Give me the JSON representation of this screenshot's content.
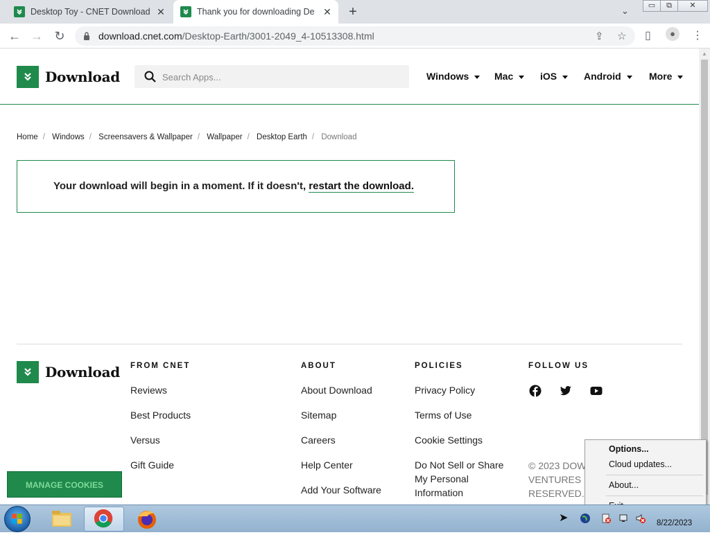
{
  "browser": {
    "tabs": [
      {
        "title": "Desktop Toy - CNET Download",
        "active": false
      },
      {
        "title": "Thank you for downloading Des",
        "active": true
      }
    ],
    "url_host": "download.cnet.com",
    "url_path": "/Desktop-Earth/3001-2049_4-10513308.html"
  },
  "header": {
    "logo_text": "Download",
    "search_placeholder": "Search Apps...",
    "nav": [
      "Windows",
      "Mac",
      "iOS",
      "Android",
      "More"
    ]
  },
  "breadcrumb": [
    "Home",
    "Windows",
    "Screensavers & Wallpaper",
    "Wallpaper",
    "Desktop Earth",
    "Download"
  ],
  "message": {
    "text": "Your download will begin in a moment. If it doesn't,",
    "link": "restart the download."
  },
  "footer": {
    "logo_text": "Download",
    "columns": [
      {
        "heading": "FROM CNET",
        "links": [
          "Reviews",
          "Best Products",
          "Versus",
          "Gift Guide"
        ]
      },
      {
        "heading": "ABOUT",
        "links": [
          "About Download",
          "Sitemap",
          "Careers",
          "Help Center",
          "Add Your Software"
        ]
      },
      {
        "heading": "POLICIES",
        "links": [
          "Privacy Policy",
          "Terms of Use",
          "Cookie Settings",
          "Do Not Sell or Share",
          "My Personal",
          "Information"
        ]
      },
      {
        "heading": "FOLLOW US",
        "links": []
      }
    ],
    "social": [
      "facebook-icon",
      "twitter-icon",
      "youtube-icon"
    ],
    "copyright": [
      "© 2023 DOW",
      "VENTURES C",
      "RESERVED."
    ]
  },
  "cookie_button": "MANAGE COOKIES",
  "context_menu": [
    "Options...",
    "Cloud updates...",
    "About...",
    "Exit"
  ],
  "taskbar": {
    "apps": [
      "file-explorer-icon",
      "chrome-icon",
      "firefox-icon"
    ],
    "date": "8/22/2023"
  },
  "colors": {
    "brand": "#1f8a4c"
  }
}
